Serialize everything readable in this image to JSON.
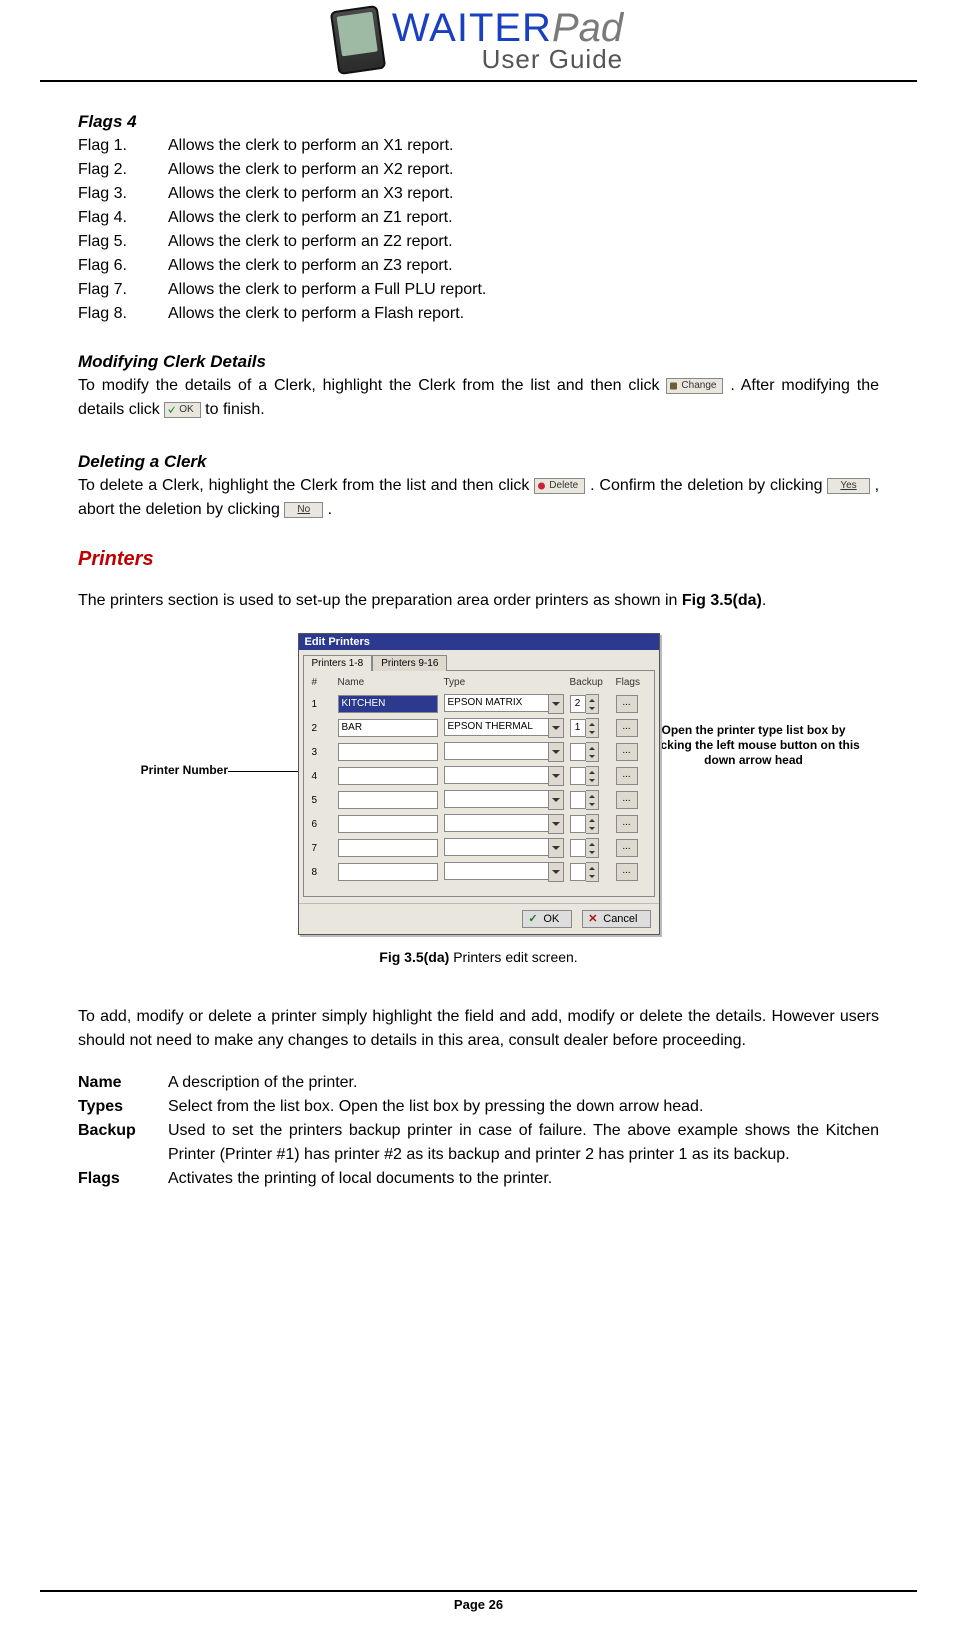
{
  "header": {
    "brand_a": "WAITER",
    "brand_b": "Pad",
    "subtitle": "User Guide"
  },
  "flags4": {
    "title": "Flags 4",
    "rows": [
      {
        "label": "Flag 1.",
        "desc": "Allows the clerk to perform an X1 report."
      },
      {
        "label": "Flag 2.",
        "desc": "Allows the clerk to perform an X2 report."
      },
      {
        "label": "Flag 3.",
        "desc": "Allows the clerk to perform an X3 report."
      },
      {
        "label": "Flag 4.",
        "desc": "Allows the clerk to perform an Z1 report."
      },
      {
        "label": "Flag 5.",
        "desc": "Allows the clerk to perform an Z2 report."
      },
      {
        "label": "Flag 6.",
        "desc": "Allows the clerk to perform an Z3 report."
      },
      {
        "label": "Flag 7.",
        "desc": "Allows the clerk to perform a Full PLU report."
      },
      {
        "label": "Flag 8.",
        "desc": "Allows the clerk to perform a Flash report."
      }
    ]
  },
  "modify": {
    "title": "Modifying Clerk Details",
    "t1": "To modify the details of a Clerk, highlight the Clerk from the list and then click ",
    "btn_change": "Change",
    "t2": ". After modifying the details click ",
    "btn_ok": "OK",
    "t3": " to finish."
  },
  "delete": {
    "title": "Deleting a Clerk",
    "t1": "To delete a Clerk, highlight the Clerk from the list and then click ",
    "btn_delete": "Delete",
    "t2": ". Confirm the deletion by clicking ",
    "btn_yes": "Yes",
    "t3": ", abort the deletion by clicking ",
    "btn_no": "No",
    "t4": "."
  },
  "printers": {
    "heading": "Printers",
    "intro_a": "The printers section is used to set-up the preparation area order printers as shown in ",
    "intro_ref": "Fig 3.5(da)",
    "intro_b": "."
  },
  "dialog": {
    "title": "Edit Printers",
    "tab1": "Printers 1-8",
    "tab2": "Printers 9-16",
    "col_hash": "#",
    "col_name": "Name",
    "col_type": "Type",
    "col_backup": "Backup",
    "col_flags": "Flags",
    "rows": [
      {
        "n": "1",
        "name": "KITCHEN",
        "type": "EPSON MATRIX",
        "backup": "2"
      },
      {
        "n": "2",
        "name": "BAR",
        "type": "EPSON THERMAL",
        "backup": "1"
      },
      {
        "n": "3",
        "name": "",
        "type": "",
        "backup": ""
      },
      {
        "n": "4",
        "name": "",
        "type": "",
        "backup": ""
      },
      {
        "n": "5",
        "name": "",
        "type": "",
        "backup": ""
      },
      {
        "n": "6",
        "name": "",
        "type": "",
        "backup": ""
      },
      {
        "n": "7",
        "name": "",
        "type": "",
        "backup": ""
      },
      {
        "n": "8",
        "name": "",
        "type": "",
        "backup": ""
      }
    ],
    "flag_btn": "...",
    "ok": "OK",
    "cancel": "Cancel"
  },
  "callouts": {
    "left": "Printer Number",
    "right": "Open the printer type list box by clicking the left mouse button on this down arrow head"
  },
  "figcap": {
    "ref": "Fig 3.5(da)",
    "text": " Printers edit screen."
  },
  "after_fig": "To add, modify or delete a printer simply highlight the field and add, modify or delete the details. However users should not need to make any changes to details in this area, consult dealer before proceeding.",
  "defs": [
    {
      "t": "Name",
      "d": "A description of the printer."
    },
    {
      "t": "Types",
      "d": "Select from the list box. Open the list box by pressing the down arrow head."
    },
    {
      "t": "Backup",
      "d": "Used to set the printers backup printer in case of failure. The above example shows the Kitchen Printer (Printer #1) has printer #2 as its backup and printer 2 has printer 1 as its backup."
    },
    {
      "t": "Flags",
      "d": "Activates the printing of local documents to the printer."
    }
  ],
  "footer": {
    "page": "Page 26"
  }
}
